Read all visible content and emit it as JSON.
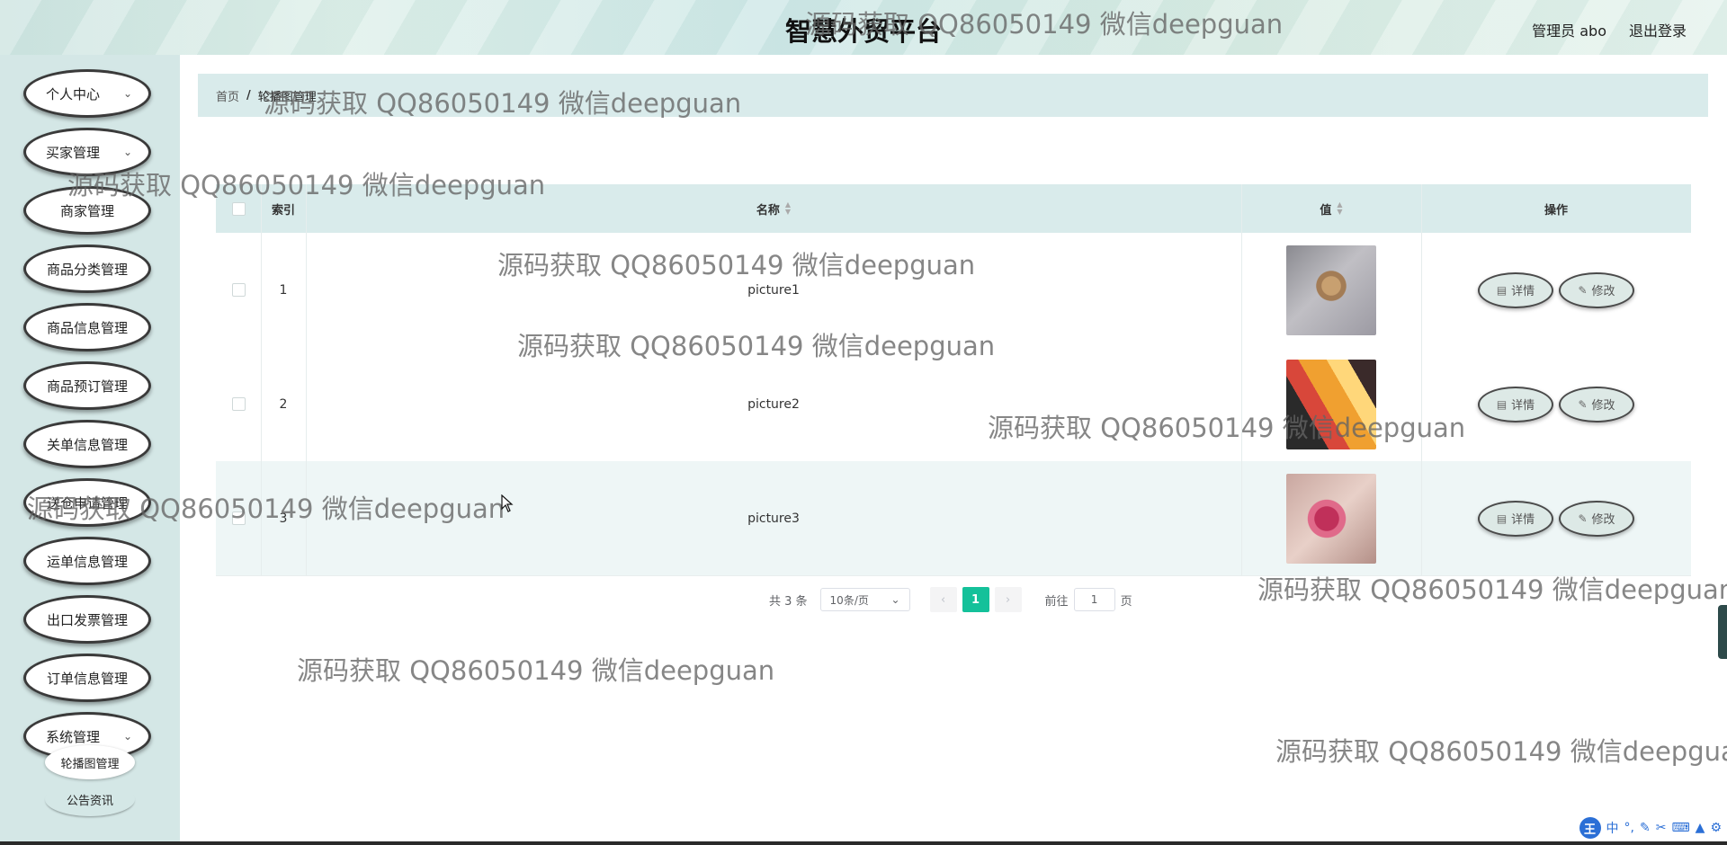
{
  "header": {
    "title": "智慧外贸平台",
    "admin_label": "管理员 abo",
    "logout_label": "退出登录"
  },
  "sidebar": {
    "items": [
      {
        "label": "个人中心",
        "chevron": true
      },
      {
        "label": "买家管理",
        "chevron": true
      },
      {
        "label": "商家管理",
        "chevron": false
      },
      {
        "label": "商品分类管理",
        "chevron": false
      },
      {
        "label": "商品信息管理",
        "chevron": false
      },
      {
        "label": "商品预订管理",
        "chevron": false
      },
      {
        "label": "关单信息管理",
        "chevron": false
      },
      {
        "label": "送仓申请管理",
        "chevron": false
      },
      {
        "label": "运单信息管理",
        "chevron": false
      },
      {
        "label": "出口发票管理",
        "chevron": false
      },
      {
        "label": "订单信息管理",
        "chevron": false
      },
      {
        "label": "系统管理",
        "chevron": true
      }
    ],
    "sub_items": [
      {
        "label": "轮播图管理"
      },
      {
        "label": "公告资讯"
      }
    ]
  },
  "breadcrumb": {
    "home": "首页",
    "separator": "/",
    "current": "轮播图管理"
  },
  "table": {
    "headers": {
      "index": "索引",
      "name": "名称",
      "value": "值",
      "actions": "操作"
    },
    "rows": [
      {
        "index": "1",
        "name": "picture1"
      },
      {
        "index": "2",
        "name": "picture2"
      },
      {
        "index": "3",
        "name": "picture3"
      }
    ],
    "detail_label": "详情",
    "edit_label": "修改"
  },
  "pagination": {
    "total": "共 3 条",
    "page_size": "10条/页",
    "current_page": "1",
    "goto_prefix": "前往",
    "goto_value": "1",
    "goto_suffix": "页"
  },
  "watermark": "源码获取 QQ86050149 微信deepguan",
  "ime": {
    "mode": "中",
    "logo": "王"
  },
  "colors": {
    "accent": "#14c19a",
    "sidebar_bg": "#d4e7e6",
    "breadcrumb_bg": "#d9ebeb"
  }
}
